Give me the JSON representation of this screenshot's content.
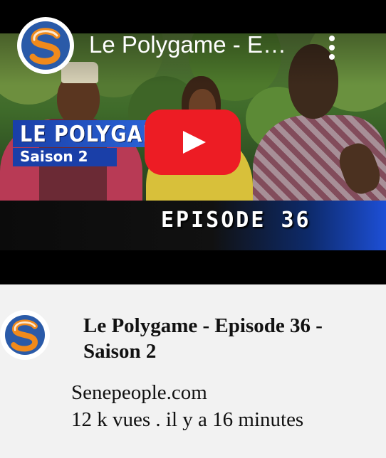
{
  "player": {
    "title": "Le Polygame - E…",
    "thumbnail": {
      "banner_title": "LE POLYGAME",
      "banner_subtitle": "Saison 2",
      "episode_label": "EPISODE 36"
    },
    "play_icon": "play-icon",
    "menu_icon": "more-vertical-icon",
    "colors": {
      "play_button": "#ed1c24",
      "banner": "#1a3fa8"
    }
  },
  "info": {
    "title": "Le Polygame - Episode 36 - Saison 2",
    "channel": "Senepeople.com",
    "meta": "12 k vues . il y a 16 minutes"
  },
  "channel_logo": {
    "icon": "channel-logo-s",
    "colors": {
      "primary": "#2a5aa8",
      "accent": "#f08a1c"
    }
  }
}
